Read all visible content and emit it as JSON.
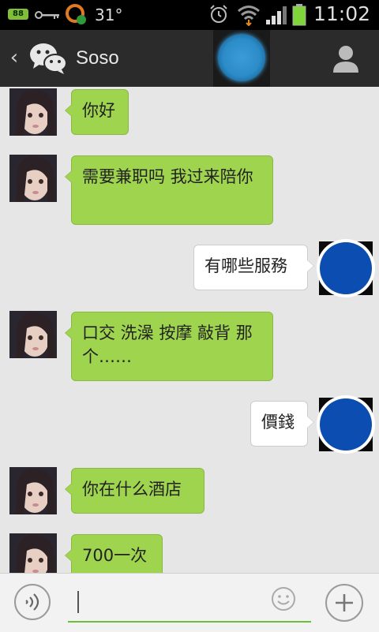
{
  "status_bar": {
    "battery_small_label": "88",
    "temperature": "31°",
    "time": "11:02",
    "icons": [
      "battery-badge-icon",
      "key-icon",
      "ring-icon",
      "alarm-icon",
      "wifi-icon",
      "signal-icon",
      "battery-icon"
    ]
  },
  "header": {
    "back_icon": "‹",
    "app_icon": "wechat-icon",
    "title": "Soso",
    "profile_icon": "person-icon"
  },
  "messages": [
    {
      "dir": "in",
      "text": "你好"
    },
    {
      "dir": "in",
      "text": "需要兼职吗 我过来陪你"
    },
    {
      "dir": "out",
      "text": "有哪些服務"
    },
    {
      "dir": "in",
      "text": "口交  洗澡  按摩  敲背 那个……"
    },
    {
      "dir": "out",
      "text": "價錢"
    },
    {
      "dir": "in",
      "text": "你在什么酒店"
    },
    {
      "dir": "in",
      "text": "700一次"
    }
  ],
  "input_bar": {
    "voice_icon": "voice-icon",
    "text_value": "",
    "emoji_icon": "smiley-icon",
    "plus_icon": "plus-icon"
  },
  "colors": {
    "incoming_bubble": "#9fd44e",
    "outgoing_bubble": "#ffffff",
    "header_bg": "#2b2b2b",
    "self_avatar": "#0b4db0",
    "input_underline": "#6bbf3a"
  }
}
